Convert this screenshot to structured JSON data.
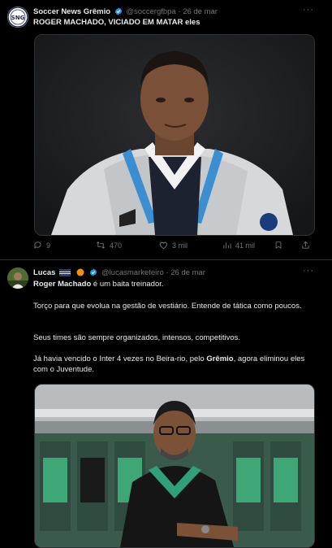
{
  "tweet1": {
    "avatar_text": "SNG",
    "display_name": "Soccer News Grêmio",
    "handle": "@soccergfbpa",
    "separator": "·",
    "date": "26 de mar",
    "more": "···",
    "text": "ROGER MACHADO, VICIADO EM MATAR eles",
    "actions": {
      "replies": "9",
      "retweets": "470",
      "likes": "3 mil",
      "views": "41 mil"
    }
  },
  "tweet2": {
    "display_name": "Lucas",
    "handle": "@lucasmarketeiro",
    "separator": "·",
    "date": "26 de mar",
    "more": "···",
    "line1_bold": "Roger Machado",
    "line1_rest": " é um baita treinador.",
    "para2": "Torço para que evolua na gestão de vestiário. Entende de tática como poucos.",
    "para3": "Seus times são sempre organizados, intensos, competitivos.",
    "para4_a": "Já havia vencido o Inter 4 vezes no Beira-rio, pelo ",
    "para4_bold": "Grêmio",
    "para4_b": ", agora eliminou eles com o Juventude."
  },
  "colors": {
    "background": "#000000",
    "text": "#e7e9ea",
    "muted": "#71767b",
    "verified_blue": "#1d9bf0",
    "divider": "#2f3336"
  }
}
